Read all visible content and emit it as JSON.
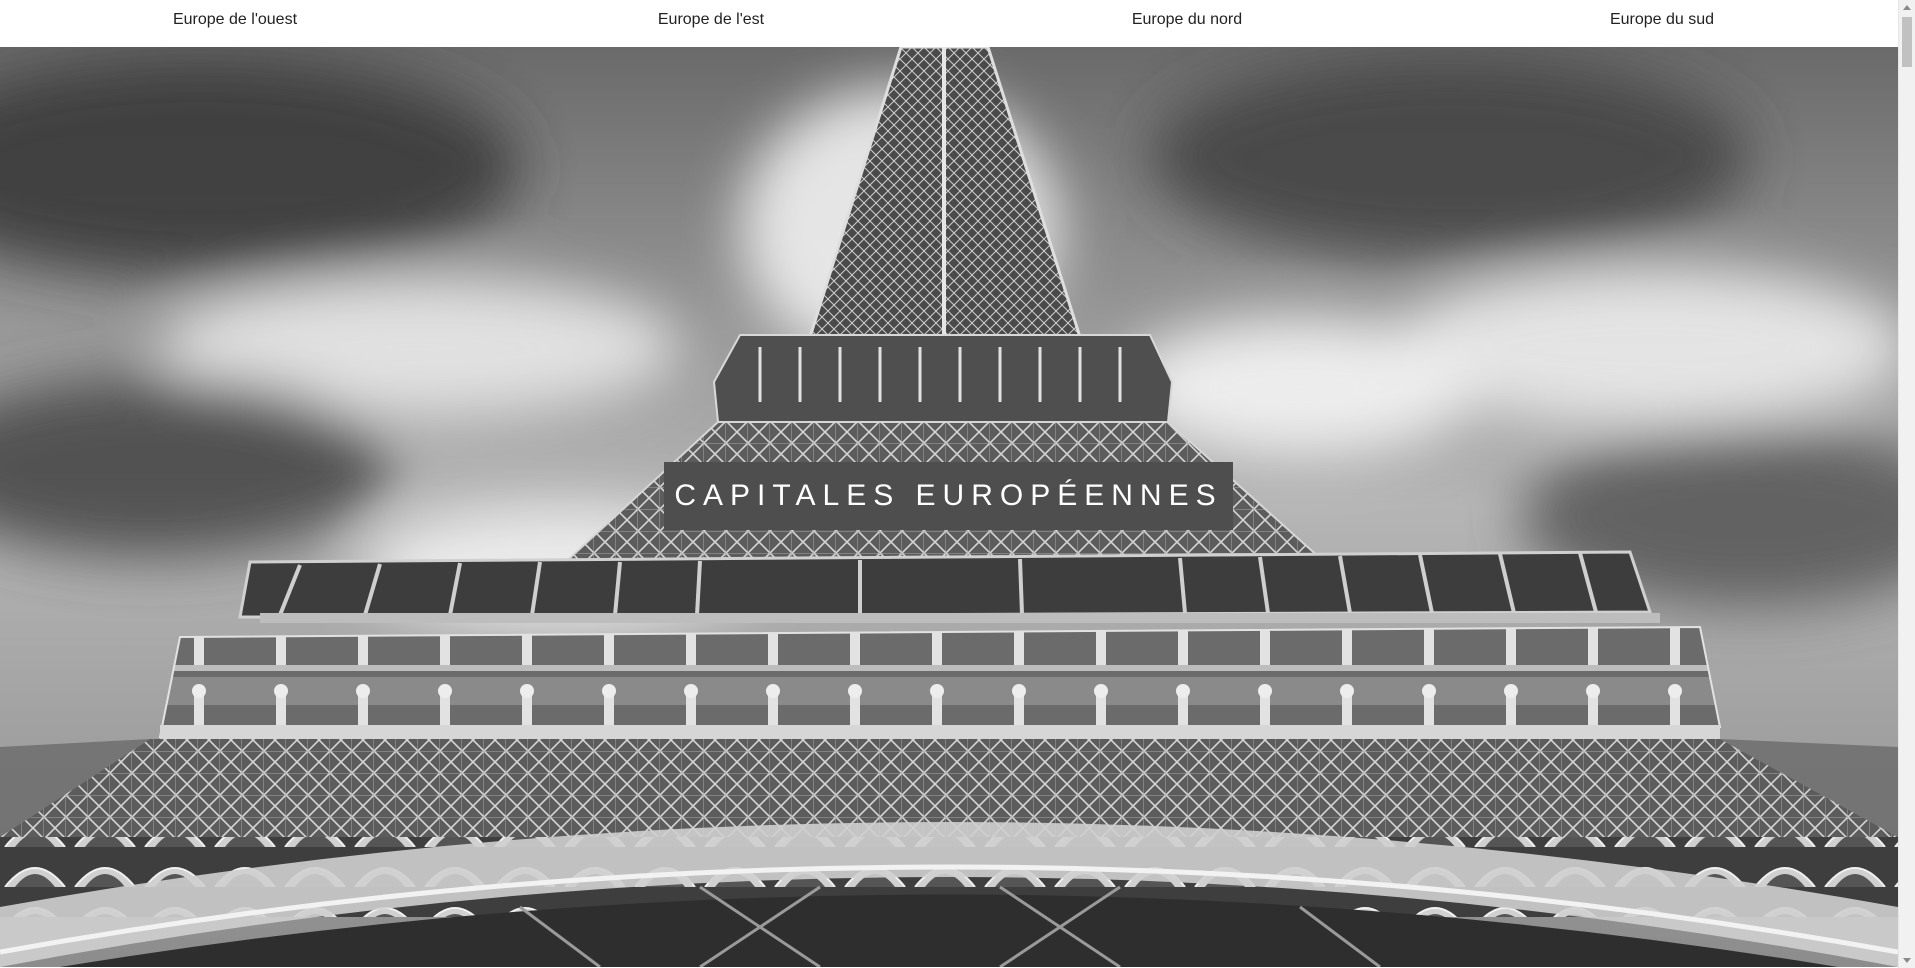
{
  "nav": {
    "items": [
      {
        "label": "Europe de l'ouest"
      },
      {
        "label": "Europe de l'est"
      },
      {
        "label": "Europe du nord"
      },
      {
        "label": "Europe du sud"
      }
    ]
  },
  "hero": {
    "title": "CAPITALES EUROPÉENNES",
    "image": "eiffel-tower-photo"
  },
  "colors": {
    "title_box": "#4e4e4e",
    "title_text": "#ffffff",
    "nav_bg": "#ffffff",
    "nav_text": "#222222"
  }
}
